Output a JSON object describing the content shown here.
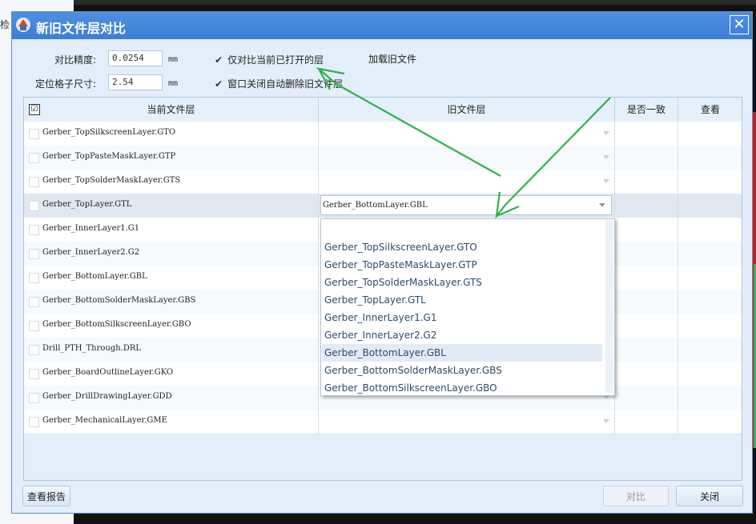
{
  "background": {
    "left_text": "检"
  },
  "window": {
    "title": "新旧文件层对比",
    "close_symbol": "✕"
  },
  "settings": {
    "precision_label": "对比精度:",
    "precision_value": "0.0254",
    "precision_unit": "mm",
    "grid_label": "定位格子尺寸:",
    "grid_value": "2.54",
    "grid_unit": "mm",
    "only_open_label": "仅对比当前已打开的层",
    "only_open_checked": true,
    "auto_delete_label": "窗口关闭自动删除旧文件层",
    "auto_delete_checked": true,
    "load_old_button": "加载旧文件"
  },
  "table": {
    "headers": {
      "current": "当前文件层",
      "old": "旧文件层",
      "match": "是否一致",
      "view": "查看"
    },
    "header_check": "☑",
    "rows": [
      {
        "name": "Gerber_TopSilkscreenLayer.GTO",
        "old": ""
      },
      {
        "name": "Gerber_TopPasteMaskLayer.GTP",
        "old": ""
      },
      {
        "name": "Gerber_TopSolderMaskLayer.GTS",
        "old": ""
      },
      {
        "name": "Gerber_TopLayer.GTL",
        "old": "Gerber_BottomLayer.GBL",
        "selected": true
      },
      {
        "name": "Gerber_InnerLayer1.G1",
        "old": ""
      },
      {
        "name": "Gerber_InnerLayer2.G2",
        "old": ""
      },
      {
        "name": "Gerber_BottomLayer.GBL",
        "old": ""
      },
      {
        "name": "Gerber_BottomSolderMaskLayer.GBS",
        "old": ""
      },
      {
        "name": "Gerber_BottomSilkscreenLayer.GBO",
        "old": ""
      },
      {
        "name": "Drill_PTH_Through.DRL",
        "old": ""
      },
      {
        "name": "Gerber_BoardOutlineLayer.GKO",
        "old": ""
      },
      {
        "name": "Gerber_DrillDrawingLayer.GDD",
        "old": ""
      },
      {
        "name": "Gerber_MechanicalLayer.GME",
        "old": ""
      }
    ]
  },
  "dropdown": {
    "items": [
      "Gerber_TopSilkscreenLayer.GTO",
      "Gerber_TopPasteMaskLayer.GTP",
      "Gerber_TopSolderMaskLayer.GTS",
      "Gerber_TopLayer.GTL",
      "Gerber_InnerLayer1.G1",
      "Gerber_InnerLayer2.G2",
      "Gerber_BottomLayer.GBL",
      "Gerber_BottomSolderMaskLayer.GBS",
      "Gerber_BottomSilkscreenLayer.GBO"
    ],
    "highlighted": "Gerber_BottomLayer.GBL"
  },
  "footer": {
    "report_button": "查看报告",
    "compare_button": "对比",
    "close_button": "关闭"
  },
  "annotation_color": "#2db34a"
}
